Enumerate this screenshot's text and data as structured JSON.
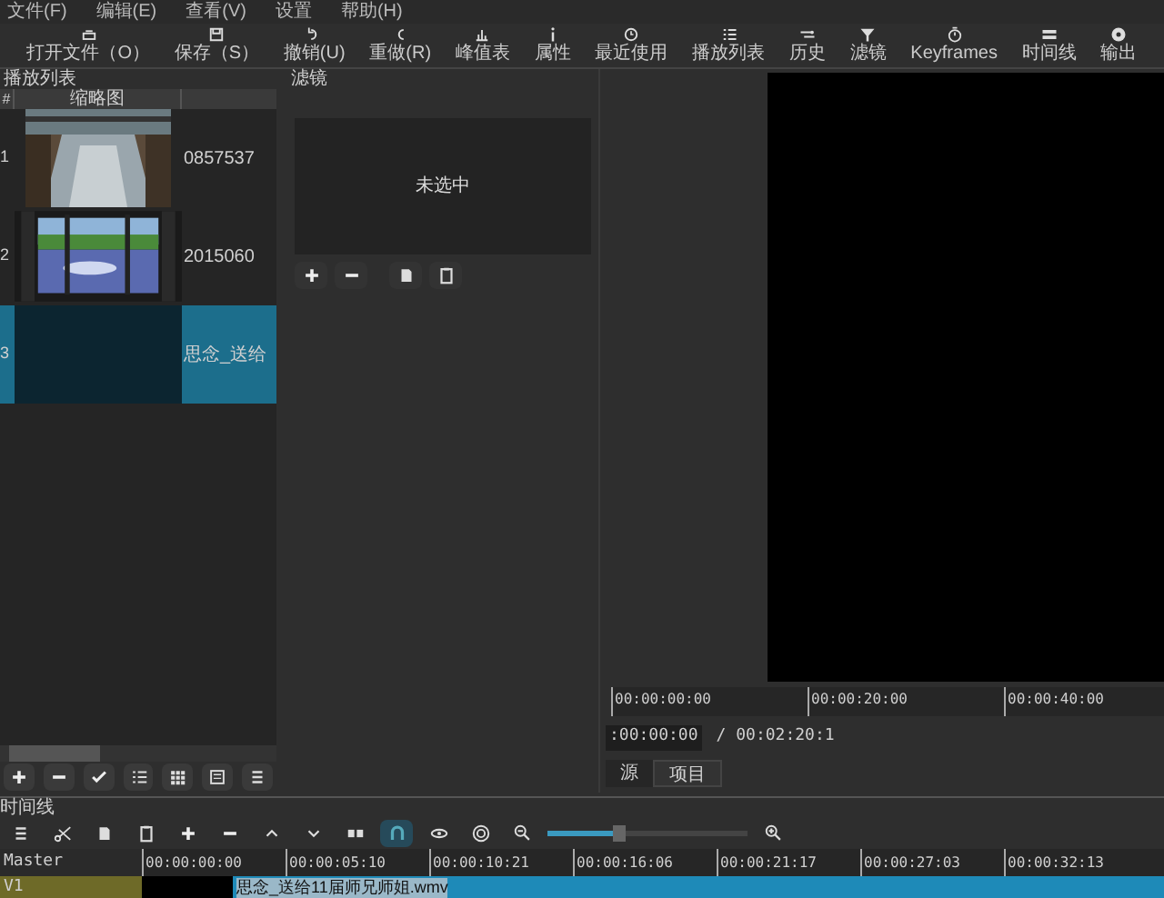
{
  "menu": [
    "文件(F)",
    "编辑(E)",
    "查看(V)",
    "设置",
    "帮助(H)"
  ],
  "toolbar": [
    {
      "label": "打开文件（O）",
      "kind": "open"
    },
    {
      "label": "保存（S）",
      "kind": "save"
    },
    {
      "label": "撤销(U)",
      "kind": "undo"
    },
    {
      "label": "重做(R)",
      "kind": "redo"
    },
    {
      "label": "峰值表",
      "kind": "meter"
    },
    {
      "label": "属性",
      "kind": "info"
    },
    {
      "label": "最近使用",
      "kind": "clock"
    },
    {
      "label": "播放列表",
      "kind": "list"
    },
    {
      "label": "历史",
      "kind": "history"
    },
    {
      "label": "滤镜",
      "kind": "filter"
    },
    {
      "label": "Keyframes",
      "kind": "stopwatch"
    },
    {
      "label": "时间线",
      "kind": "timeline"
    },
    {
      "label": "输出",
      "kind": "export"
    }
  ],
  "playlist": {
    "title": "播放列表",
    "columns": [
      "#",
      "缩略图"
    ],
    "rows": [
      {
        "index": "1",
        "name": "0857537",
        "selected": false,
        "kind": "reflection"
      },
      {
        "index": "2",
        "name": "2015060",
        "selected": false,
        "kind": "window"
      },
      {
        "index": "3",
        "name": "思念_送给",
        "selected": true,
        "kind": "empty"
      }
    ]
  },
  "filters": {
    "title": "滤镜",
    "empty_message": "未选中"
  },
  "player": {
    "ruler": [
      "00:00:00:00",
      "00:00:20:00",
      "00:00:40:00"
    ],
    "position": ":00:00:00",
    "duration": "/ 00:02:20:1",
    "tabs": [
      {
        "label": "源",
        "selected": true
      },
      {
        "label": "项目",
        "selected": false
      }
    ]
  },
  "timeline": {
    "title": "时间线",
    "zoom": {
      "level": 0.35
    },
    "ruler": [
      "00:00:00:00",
      "00:00:05:10",
      "00:00:10:21",
      "00:00:16:06",
      "00:00:21:17",
      "00:00:27:03",
      "00:00:32:13"
    ],
    "tracks": [
      {
        "name": "Master"
      },
      {
        "name": "V1",
        "clip": "思念_送给11届师兄师姐.wmv"
      }
    ]
  }
}
